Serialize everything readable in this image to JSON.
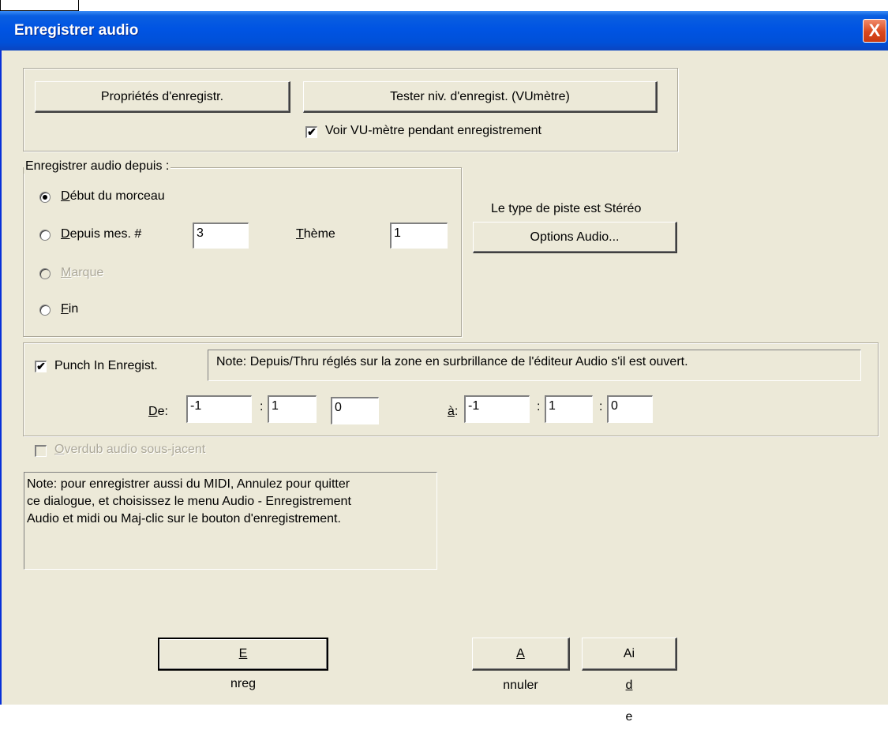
{
  "window": {
    "title": "Enregistrer audio",
    "close_glyph": "X"
  },
  "top_group": {
    "props_button": "Propriétés d'enregistr.",
    "test_button": "Tester niv. d'enregist. (VUmètre)",
    "vu_checkbox": {
      "label": "Voir VU-mètre pendant enregistrement",
      "checked": true
    }
  },
  "record_from": {
    "legend": "Enregistrer audio depuis :",
    "options": {
      "debut": {
        "first": "D",
        "rest": "ébut du morceau",
        "selected": true
      },
      "depuis": {
        "first": "D",
        "rest": "epuis mes. #",
        "selected": false
      },
      "marque": {
        "first": "M",
        "rest": "arque",
        "disabled": true
      },
      "fin": {
        "first": "F",
        "rest": "in",
        "selected": false
      }
    },
    "measure_value": "3",
    "theme_label": {
      "first": "T",
      "rest": "hème"
    },
    "theme_value": "1"
  },
  "track_type_text": "Le type de piste est Stéréo",
  "audio_options_button": "Options Audio...",
  "punch": {
    "checkbox_label": "Punch In Enregist.",
    "checked": true,
    "note": "Note: Depuis/Thru réglés sur la zone en surbrillance de l'éditeur Audio s'il est ouvert.",
    "from_label": {
      "first": "D",
      "rest": "e:"
    },
    "from_values": [
      "-1",
      "1",
      "0"
    ],
    "to_label": {
      "first": "à",
      "rest": ":"
    },
    "to_values": [
      "-1",
      "1",
      "0"
    ],
    "separator": ":"
  },
  "overdub": {
    "first": "O",
    "rest": "verdub audio sous-jacent",
    "checked": false,
    "disabled": true
  },
  "midi_note": {
    "line1": "Note: pour enregistrer aussi du MIDI, Annulez pour quitter",
    "line2": "ce dialogue, et choisissez le menu Audio - Enregistrement",
    "line3": "Audio et midi ou Maj-clic sur le bouton d'enregistrement."
  },
  "buttons": {
    "enreg": {
      "first": "E",
      "rest": "nreg"
    },
    "annuler": {
      "first": "A",
      "rest": "nnuler"
    },
    "aide": {
      "pre": "Ai",
      "u": "d",
      "post": "e"
    }
  },
  "check_glyph": "✔"
}
